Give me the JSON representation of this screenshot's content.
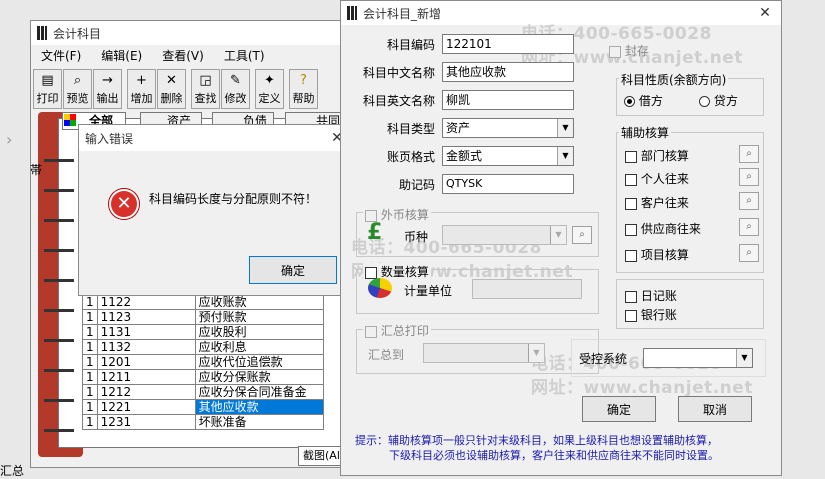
{
  "background_text": "汇总",
  "watermarks": [
    {
      "phone": "电话：400-665-0028",
      "site": "网址：www.chanjet.net"
    }
  ],
  "main_window": {
    "title": "会计科目",
    "menu": [
      "文件(F)",
      "编辑(E)",
      "查看(V)",
      "工具(T)"
    ],
    "toolbar": [
      "打印",
      "预览",
      "输出",
      "增加",
      "删除",
      "查找",
      "修改",
      "定义",
      "帮助"
    ],
    "tabs": [
      "全部",
      "资产",
      "负债",
      "共同"
    ],
    "tab_left_text": "帯"
  },
  "account_table": {
    "rows": [
      {
        "level": "1",
        "code": "1122",
        "name": "应收账款"
      },
      {
        "level": "1",
        "code": "1123",
        "name": "预付账款"
      },
      {
        "level": "1",
        "code": "1131",
        "name": "应收股利"
      },
      {
        "level": "1",
        "code": "1132",
        "name": "应收利息"
      },
      {
        "level": "1",
        "code": "1201",
        "name": "应收代位追偿款"
      },
      {
        "level": "1",
        "code": "1211",
        "name": "应收分保账款"
      },
      {
        "level": "1",
        "code": "1212",
        "name": "应收分保合同准备金"
      },
      {
        "level": "1",
        "code": "1221",
        "name": "其他应收款",
        "selected": true
      },
      {
        "level": "1",
        "code": "1231",
        "name": "坏账准备"
      }
    ]
  },
  "error_dialog": {
    "title": "输入错误",
    "message": "科目编码长度与分配原则不符！",
    "ok_label": "确定"
  },
  "tooltip": "截图(Alt + A)",
  "new_account_dialog": {
    "title": "会计科目_新增",
    "code_label": "科目编码",
    "code_value": "122101",
    "cn_name_label": "科目中文名称",
    "cn_name_value": "其他应收款",
    "en_name_label": "科目英文名称",
    "en_name_value": "柳凯",
    "type_label": "科目类型",
    "type_value": "资产",
    "format_label": "账页格式",
    "format_value": "金额式",
    "mnemonic_label": "助记码",
    "mnemonic_value": "QTYSK",
    "sealed_label": "封存",
    "nature_group": "科目性质(余额方向)",
    "debit_label": "借方",
    "credit_label": "贷方",
    "aux_group": "辅助核算",
    "aux_items": [
      "部门核算",
      "个人往来",
      "客户往来",
      "供应商往来",
      "项目核算"
    ],
    "journal_label": "日记账",
    "bank_label": "银行账",
    "foreign_group": "外币核算",
    "currency_label": "币种",
    "quantity_group": "数量核算",
    "unit_label": "计量单位",
    "summary_group": "汇总打印",
    "summary_to_label": "汇总到",
    "controlled_label": "受控系统",
    "ok_label": "确定",
    "cancel_label": "取消",
    "hint_line1": "提示：辅助核算项一般只针对末级科目，如果上级科目也想设置辅助核算，",
    "hint_line2": "下级科目必须也设辅助核算，客户往来和供应商往来不能同时设置。"
  }
}
